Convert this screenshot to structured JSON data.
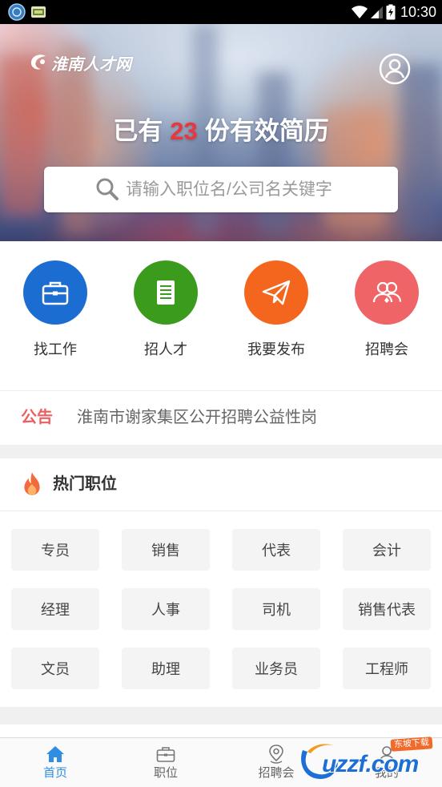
{
  "status_bar": {
    "time": "10:30",
    "icons": [
      "app-notification-icon",
      "image-notification-icon",
      "wifi-icon",
      "signal-icon",
      "battery-charging-icon"
    ]
  },
  "header": {
    "logo_text": "淮南人才网",
    "logo_icon": "logo-swirl-icon",
    "profile_icon": "user-circle-icon"
  },
  "hero": {
    "headline_prefix": "已有",
    "resume_count": "23",
    "headline_suffix": "份有效简历"
  },
  "search": {
    "placeholder": "请输入职位名/公司名关键字",
    "icon": "search-icon"
  },
  "features": [
    {
      "label": "找工作",
      "icon": "briefcase-icon",
      "color": "#1b6dd1"
    },
    {
      "label": "招人才",
      "icon": "document-list-icon",
      "color": "#3b9b1c"
    },
    {
      "label": "我要发布",
      "icon": "paper-plane-icon",
      "color": "#f4661d"
    },
    {
      "label": "招聘会",
      "icon": "people-icon",
      "color": "#ef6466"
    }
  ],
  "notice": {
    "tag": "公告",
    "text": "淮南市谢家集区公开招聘公益性岗"
  },
  "hot_jobs": {
    "title": "热门职位",
    "icon": "fire-icon",
    "tags": [
      "专员",
      "销售",
      "代表",
      "会计",
      "经理",
      "人事",
      "司机",
      "销售代表",
      "文员",
      "助理",
      "业务员",
      "工程师"
    ]
  },
  "bottom_nav": {
    "items": [
      {
        "label": "首页",
        "icon": "home-icon",
        "active": true
      },
      {
        "label": "职位",
        "icon": "briefcase-icon",
        "active": false
      },
      {
        "label": "招聘会",
        "icon": "location-pin-icon",
        "active": false
      },
      {
        "label": "我的",
        "icon": "user-icon",
        "active": false
      }
    ]
  },
  "watermark": {
    "text": "uzzf.com",
    "badge": "东坡下载"
  },
  "colors": {
    "accent_blue": "#2f8de4",
    "count_red": "#e8383d",
    "notice_red": "#ef5f61",
    "status_bar": "#000000",
    "section_gap": "#f0f0f0",
    "tag_background": "#f4f4f4"
  }
}
